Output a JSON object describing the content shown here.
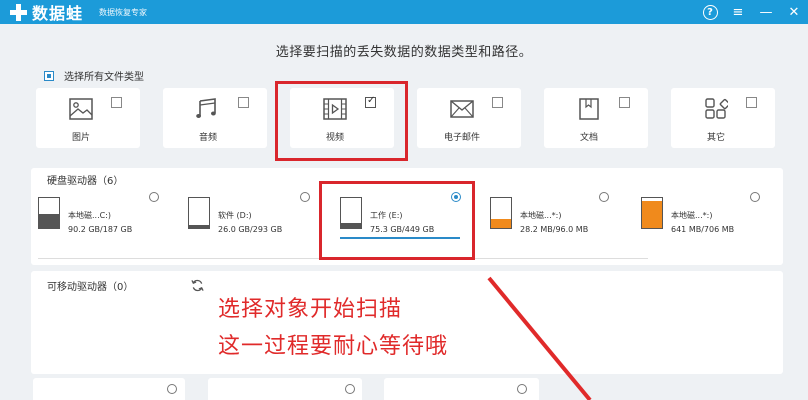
{
  "app": {
    "brand": "数据蛙",
    "tagline": "数据恢复专家"
  },
  "window_controls": {
    "help": "?",
    "menu": "≡",
    "minimize": "—",
    "close": "✕"
  },
  "heading": "选择要扫描的丢失数据的数据类型和路径。",
  "select_all_label": "选择所有文件类型",
  "file_types": [
    {
      "label": "图片",
      "icon": "image-icon",
      "checked": false
    },
    {
      "label": "音频",
      "icon": "music-icon",
      "checked": false
    },
    {
      "label": "视频",
      "icon": "video-icon",
      "checked": true
    },
    {
      "label": "电子邮件",
      "icon": "email-icon",
      "checked": false
    },
    {
      "label": "文档",
      "icon": "document-icon",
      "checked": false
    },
    {
      "label": "其它",
      "icon": "other-icon",
      "checked": false
    }
  ],
  "hard_drives": {
    "title": "硬盘驱动器（6）",
    "items": [
      {
        "name": "本地磁...C:)",
        "size": "90.2 GB/187 GB",
        "fill_color": "#555555",
        "fill_fraction": 0.48,
        "selected": false
      },
      {
        "name": "软件 (D:)",
        "size": "26.0 GB/293 GB",
        "fill_color": "#555555",
        "fill_fraction": 0.09,
        "selected": false
      },
      {
        "name": "工作 (E:)",
        "size": "75.3 GB/449 GB",
        "fill_color": "#555555",
        "fill_fraction": 0.17,
        "selected": true
      },
      {
        "name": "本地磁...*:)",
        "size": "28.2 MB/96.0 MB",
        "fill_color": "#f08a1c",
        "fill_fraction": 0.29,
        "selected": false
      },
      {
        "name": "本地磁...*:)",
        "size": "641 MB/706 MB",
        "fill_color": "#f08a1c",
        "fill_fraction": 0.91,
        "selected": false
      }
    ]
  },
  "removable_drives": {
    "title": "可移动驱动器（0）",
    "refresh_icon": "refresh-icon"
  },
  "annotation": {
    "line1": "选择对象开始扫描",
    "line2": "这一过程要耐心等待哦"
  },
  "colors": {
    "titlebar": "#1c9bd9",
    "accent": "#2a8ac8",
    "annotation": "#e02a2a"
  }
}
